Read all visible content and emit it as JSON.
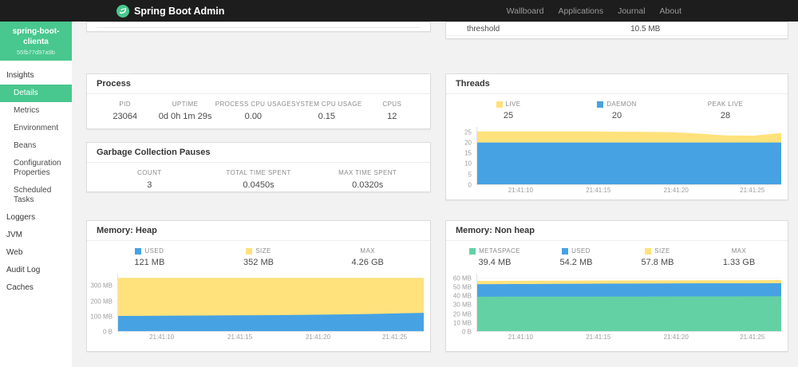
{
  "navbar": {
    "brand": "Spring Boot Admin",
    "links": [
      "Wallboard",
      "Applications",
      "Journal",
      "About"
    ]
  },
  "sidebar": {
    "instance_name_line1": "spring-boot-",
    "instance_name_line2": "clienta",
    "instance_id": "55fb77d97a9b",
    "items": [
      {
        "label": "Insights",
        "sub": false,
        "active": false
      },
      {
        "label": "Details",
        "sub": true,
        "active": true
      },
      {
        "label": "Metrics",
        "sub": true,
        "active": false
      },
      {
        "label": "Environment",
        "sub": true,
        "active": false
      },
      {
        "label": "Beans",
        "sub": true,
        "active": false
      },
      {
        "label": "Configuration Properties",
        "sub": true,
        "active": false
      },
      {
        "label": "Scheduled Tasks",
        "sub": true,
        "active": false
      },
      {
        "label": "Loggers",
        "sub": false,
        "active": false
      },
      {
        "label": "JVM",
        "sub": false,
        "active": false
      },
      {
        "label": "Web",
        "sub": false,
        "active": false
      },
      {
        "label": "Audit Log",
        "sub": false,
        "active": false
      },
      {
        "label": "Caches",
        "sub": false,
        "active": false
      }
    ]
  },
  "partial": {
    "threshold_label": "threshold",
    "threshold_value": "10.5 MB"
  },
  "process": {
    "title": "Process",
    "metrics": [
      {
        "label": "PID",
        "value": "23064"
      },
      {
        "label": "UPTIME",
        "value": "0d 0h 1m 29s"
      },
      {
        "label": "PROCESS CPU USAGE",
        "value": "0.00"
      },
      {
        "label": "SYSTEM CPU USAGE",
        "value": "0.15"
      },
      {
        "label": "CPUS",
        "value": "12"
      }
    ]
  },
  "gc": {
    "title": "Garbage Collection Pauses",
    "metrics": [
      {
        "label": "COUNT",
        "value": "3"
      },
      {
        "label": "TOTAL TIME SPENT",
        "value": "0.0450s"
      },
      {
        "label": "MAX TIME SPENT",
        "value": "0.0320s"
      }
    ]
  },
  "threads": {
    "title": "Threads",
    "legend": [
      {
        "label": "LIVE",
        "value": "25",
        "color": "#ffe27c"
      },
      {
        "label": "DAEMON",
        "value": "20",
        "color": "#47a2e4"
      },
      {
        "label": "PEAK LIVE",
        "value": "28",
        "color": ""
      }
    ]
  },
  "heap": {
    "title": "Memory: Heap",
    "legend": [
      {
        "label": "USED",
        "value": "121 MB",
        "color": "#47a2e4"
      },
      {
        "label": "SIZE",
        "value": "352 MB",
        "color": "#ffe27c"
      },
      {
        "label": "MAX",
        "value": "4.26 GB",
        "color": ""
      }
    ]
  },
  "nonheap": {
    "title": "Memory: Non heap",
    "legend": [
      {
        "label": "METASPACE",
        "value": "39.4 MB",
        "color": "#63d1a4"
      },
      {
        "label": "USED",
        "value": "54.2 MB",
        "color": "#47a2e4"
      },
      {
        "label": "SIZE",
        "value": "57.8 MB",
        "color": "#ffe27c"
      },
      {
        "label": "MAX",
        "value": "1.33 GB",
        "color": ""
      }
    ]
  },
  "chart_data": [
    {
      "id": "threads",
      "type": "area",
      "title": "Threads",
      "ylim": [
        0,
        27.5
      ],
      "grid": true,
      "yticks": [
        {
          "v": 0,
          "label": "0"
        },
        {
          "v": 5,
          "label": "5"
        },
        {
          "v": 10,
          "label": "10"
        },
        {
          "v": 15,
          "label": "15"
        },
        {
          "v": 20,
          "label": "20"
        },
        {
          "v": 25,
          "label": "25"
        }
      ],
      "x_labels": [
        "21:41:10",
        "21:41:15",
        "21:41:20",
        "21:41:25"
      ],
      "x_positions": [
        14.5,
        40,
        65.5,
        90.5
      ],
      "series": [
        {
          "name": "LIVE",
          "color": "#ffe27c",
          "values": [
            25.3,
            25.3,
            25.3,
            25.3,
            25.3,
            25.2,
            25.1,
            24.9,
            24.3,
            23.4,
            23.3,
            24.6
          ]
        },
        {
          "name": "DAEMON",
          "color": "#47a2e4",
          "values": [
            20,
            20,
            20,
            20,
            20,
            20,
            20,
            20,
            20,
            20,
            20,
            20
          ]
        }
      ]
    },
    {
      "id": "heap",
      "type": "area",
      "title": "Memory: Heap",
      "ylim": [
        0,
        380
      ],
      "grid": true,
      "yticks": [
        {
          "v": 0,
          "label": "0 B"
        },
        {
          "v": 100,
          "label": "100 MB"
        },
        {
          "v": 200,
          "label": "200 MB"
        },
        {
          "v": 300,
          "label": "300 MB"
        }
      ],
      "x_labels": [
        "21:41:10",
        "21:41:15",
        "21:41:20",
        "21:41:25"
      ],
      "x_positions": [
        14.5,
        40,
        65.5,
        90.5
      ],
      "series": [
        {
          "name": "SIZE",
          "color": "#ffe27c",
          "values": [
            352,
            352,
            352,
            352,
            352,
            352,
            352,
            352,
            352,
            352,
            352,
            352
          ]
        },
        {
          "name": "USED",
          "color": "#47a2e4",
          "values": [
            100,
            101,
            102,
            103,
            104,
            105,
            106,
            108,
            110,
            113,
            117,
            121
          ]
        }
      ]
    },
    {
      "id": "nonheap",
      "type": "area",
      "title": "Memory: Non heap",
      "ylim": [
        0,
        65
      ],
      "grid": true,
      "yticks": [
        {
          "v": 0,
          "label": "0 B"
        },
        {
          "v": 10,
          "label": "10 MB"
        },
        {
          "v": 20,
          "label": "20 MB"
        },
        {
          "v": 30,
          "label": "30 MB"
        },
        {
          "v": 40,
          "label": "40 MB"
        },
        {
          "v": 50,
          "label": "50 MB"
        },
        {
          "v": 60,
          "label": "60 MB"
        }
      ],
      "x_labels": [
        "21:41:10",
        "21:41:15",
        "21:41:20",
        "21:41:25"
      ],
      "x_positions": [
        14.5,
        40,
        65.5,
        90.5
      ],
      "series": [
        {
          "name": "SIZE",
          "color": "#ffe27c",
          "values": [
            56.8,
            56.9,
            57.0,
            57.1,
            57.2,
            57.3,
            57.4,
            57.4,
            57.5,
            57.6,
            57.7,
            57.8
          ]
        },
        {
          "name": "USED",
          "color": "#47a2e4",
          "values": [
            53.0,
            53.2,
            53.3,
            53.5,
            53.6,
            53.7,
            53.8,
            53.9,
            54.0,
            54.0,
            54.1,
            54.2
          ]
        },
        {
          "name": "METASPACE",
          "color": "#63d1a4",
          "values": [
            38.9,
            39.0,
            39.0,
            39.1,
            39.1,
            39.2,
            39.2,
            39.3,
            39.3,
            39.3,
            39.4,
            39.4
          ]
        }
      ]
    }
  ]
}
